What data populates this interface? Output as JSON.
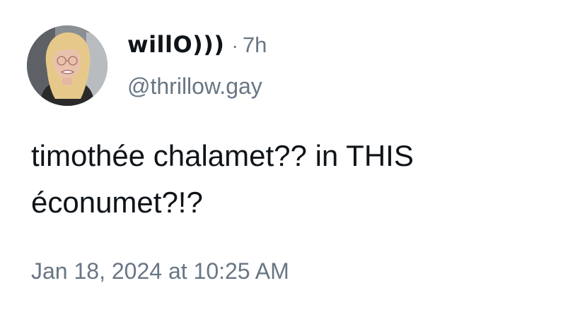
{
  "post": {
    "display_name": "willO)))",
    "separator": "·",
    "time_ago": "7h",
    "handle": "@thrillow.gay",
    "text_line1": "timothée chalamet?? in THIS",
    "text_line2": "éconumet?!?",
    "timestamp": "Jan 18, 2024 at 10:25 AM"
  },
  "avatar": {
    "icon": "profile-photo",
    "hair_color": "#e6c98a",
    "skin_color": "#e9c2ad",
    "background_color": "#8a8f94"
  },
  "colors": {
    "primary_text": "#0f1419",
    "secondary_text": "#687684",
    "background": "#ffffff"
  }
}
